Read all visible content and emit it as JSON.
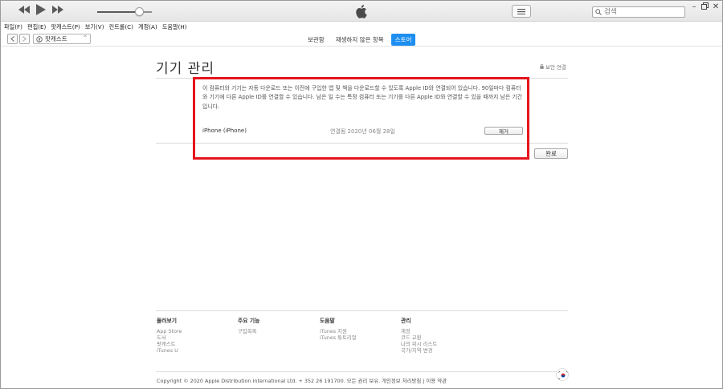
{
  "search": {
    "placeholder": "검색"
  },
  "menu": [
    "파일(F)",
    "편집(E)",
    "팟캐스트(P)",
    "보기(V)",
    "컨트롤(C)",
    "계정(A)",
    "도움말(H)"
  ],
  "nav": {
    "media_label": "팟캐스트",
    "tabs": [
      "보관함",
      "재생하지 않은 항목",
      "스토어"
    ],
    "active_tab": "스토어"
  },
  "content": {
    "title": "기기 관리",
    "secure_link": "보안 연결",
    "description": "이 컴퓨터와 기기는 자동 다운로드 또는 이전에 구입한 앱 및 책을 다운로드할 수 있도록 Apple ID와 연결되어 있습니다. 90일마다 컴퓨터와 기기에 다른 Apple ID를 연결할 수 있습니다. 남은 일 수는 특정 컴퓨터 또는 기기를 다른 Apple ID와 연결할 수 있을 때까지 남은 기간입니다.",
    "device_name": "iPhone (iPhone)",
    "connected_date": "연결됨 2020년 06월 28일",
    "remove_label": "제거",
    "done_label": "완료"
  },
  "footer": {
    "columns": [
      {
        "heading": "둘러보기",
        "links": [
          "App Store",
          "도서",
          "팟캐스트",
          "iTunes U"
        ]
      },
      {
        "heading": "주요 기능",
        "links": [
          "구입목록"
        ]
      },
      {
        "heading": "도움말",
        "links": [
          "iTunes 지원",
          "iTunes 튜토리얼"
        ]
      },
      {
        "heading": "관리",
        "links": [
          "계정",
          "코드 교환",
          "나의 위시 리스트",
          "국가/지역 변경"
        ]
      }
    ],
    "copyright": "Copyright © 2020 Apple Distribution International Ltd. + 352 26 191700. 모든 권리 보유.   개인정보 처리방침 | 이용 약관"
  },
  "colors": {
    "accent": "#1e8ff0",
    "highlight": "#e5141d"
  },
  "icons": [
    "rewind-icon",
    "play-icon",
    "fast-forward-icon",
    "apple-logo-icon",
    "list-view-icon",
    "search-icon",
    "lock-icon",
    "korea-flag-icon"
  ]
}
